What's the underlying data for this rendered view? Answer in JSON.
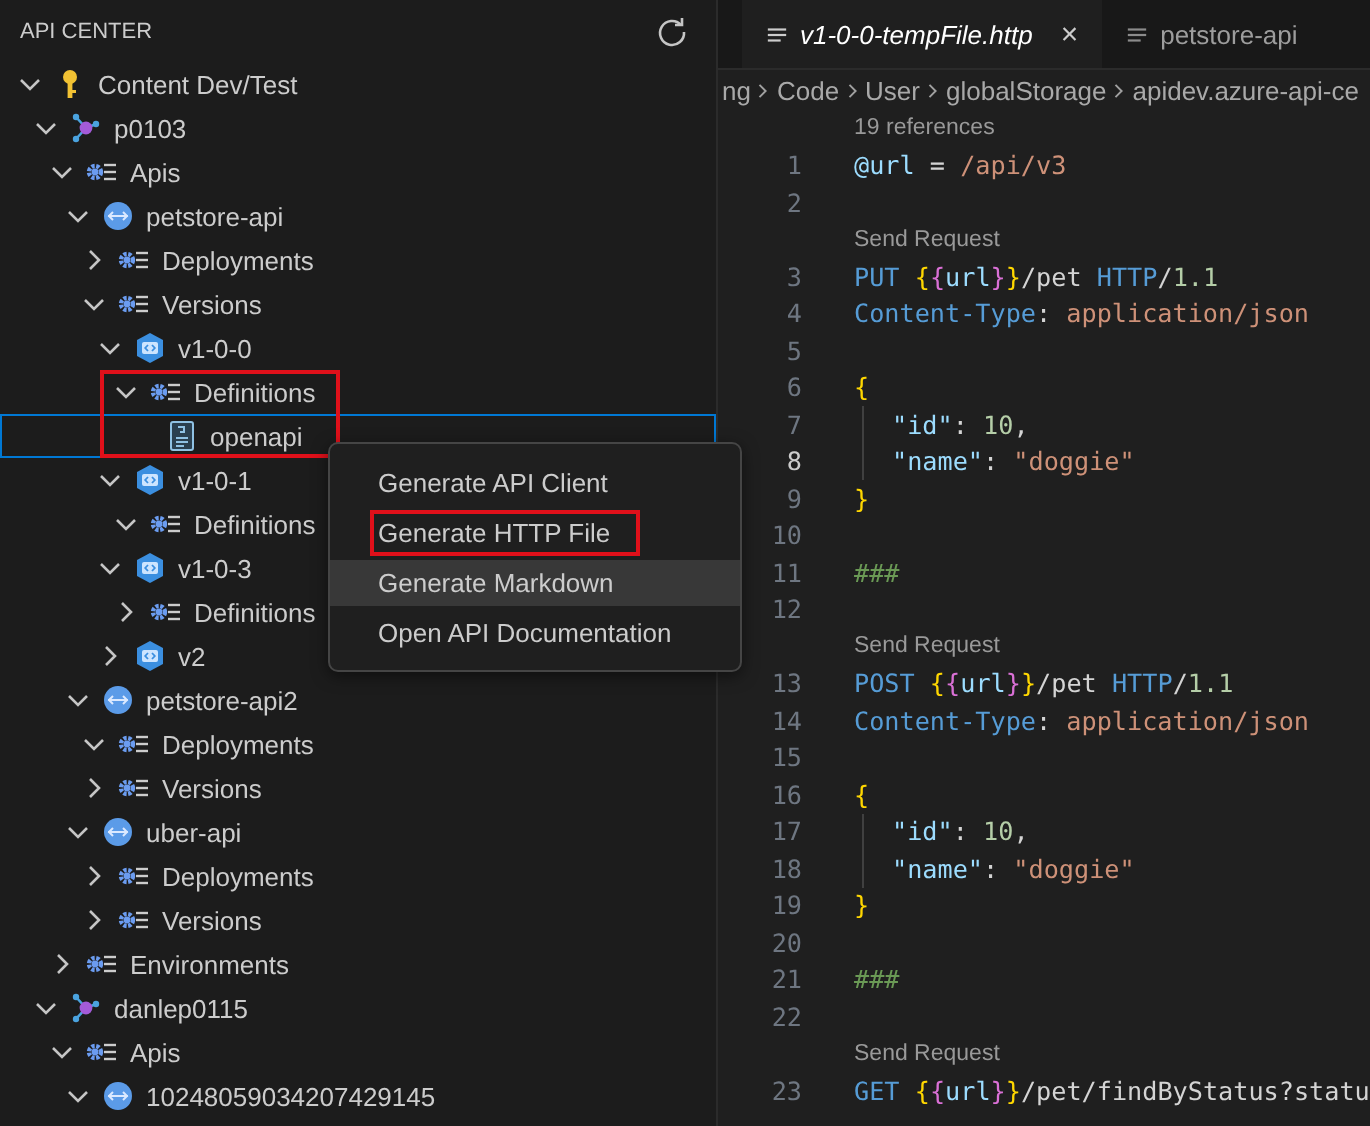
{
  "sidebar": {
    "title": "API CENTER",
    "tree": [
      {
        "label": "Content Dev/Test",
        "kind": "key",
        "expanded": true,
        "selected": false,
        "children": [
          {
            "label": "p0103",
            "kind": "service",
            "expanded": true,
            "selected": false,
            "children": [
              {
                "label": "Apis",
                "kind": "group",
                "expanded": true,
                "selected": false,
                "children": [
                  {
                    "label": "petstore-api",
                    "kind": "api",
                    "expanded": true,
                    "selected": false,
                    "children": [
                      {
                        "label": "Deployments",
                        "kind": "group",
                        "expanded": false,
                        "selected": false
                      },
                      {
                        "label": "Versions",
                        "kind": "group",
                        "expanded": true,
                        "selected": false,
                        "children": [
                          {
                            "label": "v1-0-0",
                            "kind": "version",
                            "expanded": true,
                            "selected": false,
                            "children": [
                              {
                                "label": "Definitions",
                                "kind": "group",
                                "expanded": true,
                                "selected": false,
                                "highlighted": true,
                                "children": [
                                  {
                                    "label": "openapi",
                                    "kind": "file",
                                    "selected": true
                                  }
                                ]
                              }
                            ]
                          },
                          {
                            "label": "v1-0-1",
                            "kind": "version",
                            "expanded": true,
                            "selected": false,
                            "children": [
                              {
                                "label": "Definitions",
                                "kind": "group",
                                "expanded": true,
                                "selected": false
                              }
                            ]
                          },
                          {
                            "label": "v1-0-3",
                            "kind": "version",
                            "expanded": true,
                            "selected": false,
                            "children": [
                              {
                                "label": "Definitions",
                                "kind": "group",
                                "expanded": false,
                                "selected": false
                              }
                            ]
                          },
                          {
                            "label": "v2",
                            "kind": "version",
                            "expanded": false,
                            "selected": false
                          }
                        ]
                      }
                    ]
                  },
                  {
                    "label": "petstore-api2",
                    "kind": "api",
                    "expanded": true,
                    "selected": false,
                    "children": [
                      {
                        "label": "Deployments",
                        "kind": "group",
                        "expanded": true,
                        "selected": false
                      },
                      {
                        "label": "Versions",
                        "kind": "group",
                        "expanded": false,
                        "selected": false
                      }
                    ]
                  },
                  {
                    "label": "uber-api",
                    "kind": "api",
                    "expanded": true,
                    "selected": false,
                    "children": [
                      {
                        "label": "Deployments",
                        "kind": "group",
                        "expanded": false,
                        "selected": false
                      },
                      {
                        "label": "Versions",
                        "kind": "group",
                        "expanded": false,
                        "selected": false
                      }
                    ]
                  }
                ]
              },
              {
                "label": "Environments",
                "kind": "group",
                "expanded": false,
                "selected": false
              }
            ]
          },
          {
            "label": "danlep0115",
            "kind": "service",
            "expanded": true,
            "selected": false,
            "children": [
              {
                "label": "Apis",
                "kind": "group",
                "expanded": true,
                "selected": false,
                "children": [
                  {
                    "label": "10248059034207429145",
                    "kind": "api",
                    "expanded": true,
                    "selected": false
                  }
                ]
              }
            ]
          }
        ]
      }
    ]
  },
  "context_menu": [
    {
      "label": "Generate API Client",
      "selected": false
    },
    {
      "label": "Generate HTTP File",
      "selected": false,
      "highlighted": true
    },
    {
      "label": "Generate Markdown",
      "selected": true
    },
    {
      "label": "Open API Documentation",
      "selected": false
    }
  ],
  "tabs": [
    {
      "label": "v1-0-0-tempFile.http",
      "selected": true,
      "close": "×"
    },
    {
      "label": "petstore-api",
      "selected": false
    }
  ],
  "breadcrumb": [
    "ng",
    "Code",
    "User",
    "globalStorage",
    "apidev.azure-api-ce"
  ],
  "editor": {
    "lines": [
      {
        "n": "1",
        "current": false,
        "guide": false,
        "lens": "19 references",
        "tokens": [
          {
            "kind": "var",
            "text": "@url"
          },
          {
            "kind": "text",
            "text": " = "
          },
          {
            "kind": "string",
            "text": "/api/v3"
          }
        ]
      },
      {
        "n": "2",
        "current": false,
        "guide": false
      },
      {
        "n": "3",
        "current": false,
        "guide": false,
        "lens": "Send Request",
        "tokens": [
          {
            "kind": "method",
            "text": "PUT "
          },
          {
            "kind": "brace1",
            "text": "{"
          },
          {
            "kind": "brace2",
            "text": "{"
          },
          {
            "kind": "var",
            "text": "url"
          },
          {
            "kind": "brace2",
            "text": "}"
          },
          {
            "kind": "brace1",
            "text": "}"
          },
          {
            "kind": "text",
            "text": "/pet "
          },
          {
            "kind": "method",
            "text": "HTTP"
          },
          {
            "kind": "text",
            "text": "/"
          },
          {
            "kind": "number",
            "text": "1.1"
          }
        ]
      },
      {
        "n": "4",
        "current": false,
        "guide": false,
        "tokens": [
          {
            "kind": "method",
            "text": "Content-Type"
          },
          {
            "kind": "text",
            "text": ": "
          },
          {
            "kind": "string",
            "text": "application/json"
          }
        ]
      },
      {
        "n": "5",
        "current": false,
        "guide": false
      },
      {
        "n": "6",
        "current": false,
        "guide": false,
        "tokens": [
          {
            "kind": "brace1",
            "text": "{"
          }
        ]
      },
      {
        "n": "7",
        "current": false,
        "guide": true,
        "tokens": [
          {
            "kind": "var",
            "text": "\"id\""
          },
          {
            "kind": "text",
            "text": ": "
          },
          {
            "kind": "number",
            "text": "10"
          },
          {
            "kind": "text",
            "text": ","
          }
        ]
      },
      {
        "n": "8",
        "current": true,
        "guide": true,
        "tokens": [
          {
            "kind": "var",
            "text": "\"name\""
          },
          {
            "kind": "text",
            "text": ": "
          },
          {
            "kind": "string",
            "text": "\"doggie\""
          }
        ]
      },
      {
        "n": "9",
        "current": false,
        "guide": false,
        "tokens": [
          {
            "kind": "brace1",
            "text": "}"
          }
        ]
      },
      {
        "n": "10",
        "current": false,
        "guide": false
      },
      {
        "n": "11",
        "current": false,
        "guide": false,
        "tokens": [
          {
            "kind": "comment",
            "text": "###"
          }
        ]
      },
      {
        "n": "12",
        "current": false,
        "guide": false
      },
      {
        "n": "13",
        "current": false,
        "guide": false,
        "lens": "Send Request",
        "tokens": [
          {
            "kind": "method",
            "text": "POST "
          },
          {
            "kind": "brace1",
            "text": "{"
          },
          {
            "kind": "brace2",
            "text": "{"
          },
          {
            "kind": "var",
            "text": "url"
          },
          {
            "kind": "brace2",
            "text": "}"
          },
          {
            "kind": "brace1",
            "text": "}"
          },
          {
            "kind": "text",
            "text": "/pet "
          },
          {
            "kind": "method",
            "text": "HTTP"
          },
          {
            "kind": "text",
            "text": "/"
          },
          {
            "kind": "number",
            "text": "1.1"
          }
        ]
      },
      {
        "n": "14",
        "current": false,
        "guide": false,
        "tokens": [
          {
            "kind": "method",
            "text": "Content-Type"
          },
          {
            "kind": "text",
            "text": ": "
          },
          {
            "kind": "string",
            "text": "application/json"
          }
        ]
      },
      {
        "n": "15",
        "current": false,
        "guide": false
      },
      {
        "n": "16",
        "current": false,
        "guide": false,
        "tokens": [
          {
            "kind": "brace1",
            "text": "{"
          }
        ]
      },
      {
        "n": "17",
        "current": false,
        "guide": true,
        "tokens": [
          {
            "kind": "var",
            "text": "\"id\""
          },
          {
            "kind": "text",
            "text": ": "
          },
          {
            "kind": "number",
            "text": "10"
          },
          {
            "kind": "text",
            "text": ","
          }
        ]
      },
      {
        "n": "18",
        "current": false,
        "guide": true,
        "tokens": [
          {
            "kind": "var",
            "text": "\"name\""
          },
          {
            "kind": "text",
            "text": ": "
          },
          {
            "kind": "string",
            "text": "\"doggie\""
          }
        ]
      },
      {
        "n": "19",
        "current": false,
        "guide": false,
        "tokens": [
          {
            "kind": "brace1",
            "text": "}"
          }
        ]
      },
      {
        "n": "20",
        "current": false,
        "guide": false
      },
      {
        "n": "21",
        "current": false,
        "guide": false,
        "tokens": [
          {
            "kind": "comment",
            "text": "###"
          }
        ]
      },
      {
        "n": "22",
        "current": false,
        "guide": false
      },
      {
        "n": "23",
        "current": false,
        "guide": false,
        "lens": "Send Request",
        "tokens": [
          {
            "kind": "method",
            "text": "GET "
          },
          {
            "kind": "brace1",
            "text": "{"
          },
          {
            "kind": "brace2",
            "text": "{"
          },
          {
            "kind": "var",
            "text": "url"
          },
          {
            "kind": "brace2",
            "text": "}"
          },
          {
            "kind": "brace1",
            "text": "}"
          },
          {
            "kind": "text",
            "text": "/pet/findByStatus?statu"
          }
        ]
      }
    ]
  }
}
